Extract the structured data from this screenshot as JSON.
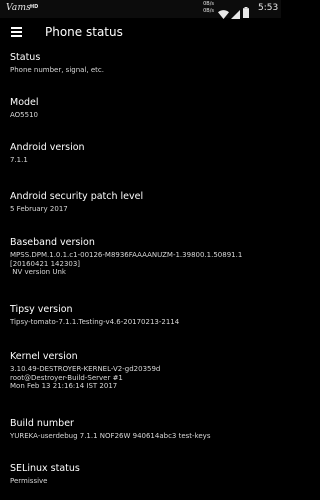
{
  "status_bar": {
    "carrier": "Vams",
    "hd_badge": "HD",
    "net_speed_up": "0B/s",
    "net_speed_down": "0B/s",
    "clock": "5:53",
    "icons": [
      "wifi-icon",
      "signal-icon",
      "battery-icon"
    ]
  },
  "app_bar": {
    "menu_icon": "menu-icon",
    "title": "Phone status"
  },
  "items": [
    {
      "title": "Status",
      "summary": [
        "Phone number, signal, etc."
      ]
    },
    {
      "title": "Model",
      "summary": [
        "AO5510"
      ]
    },
    {
      "title": "Android version",
      "summary": [
        "7.1.1"
      ]
    },
    {
      "title": "Android security patch level",
      "summary": [
        "5 February 2017"
      ]
    },
    {
      "title": "Baseband version",
      "summary": [
        "MPSS.DPM.1.0.1.c1-00126-M8936FAAAANUZM-1.39800.1.50891.1",
        "[20160421 142303]",
        " NV version Unk"
      ]
    },
    {
      "title": "Tipsy version",
      "summary": [
        "Tipsy-tomato-7.1.1.Testing-v4.6-20170213-2114"
      ]
    },
    {
      "title": "Kernel version",
      "summary": [
        "3.10.49-DESTROYER-KERNEL-V2-gd20359d",
        "root@Destroyer-Build-Server #1",
        "Mon Feb 13 21:16:14 IST 2017"
      ]
    },
    {
      "title": "Build number",
      "summary": [
        "YUREKA-userdebug 7.1.1 NOF26W 940614abc3 test-keys"
      ]
    },
    {
      "title": "SELinux status",
      "summary": [
        "Permissive"
      ]
    }
  ]
}
